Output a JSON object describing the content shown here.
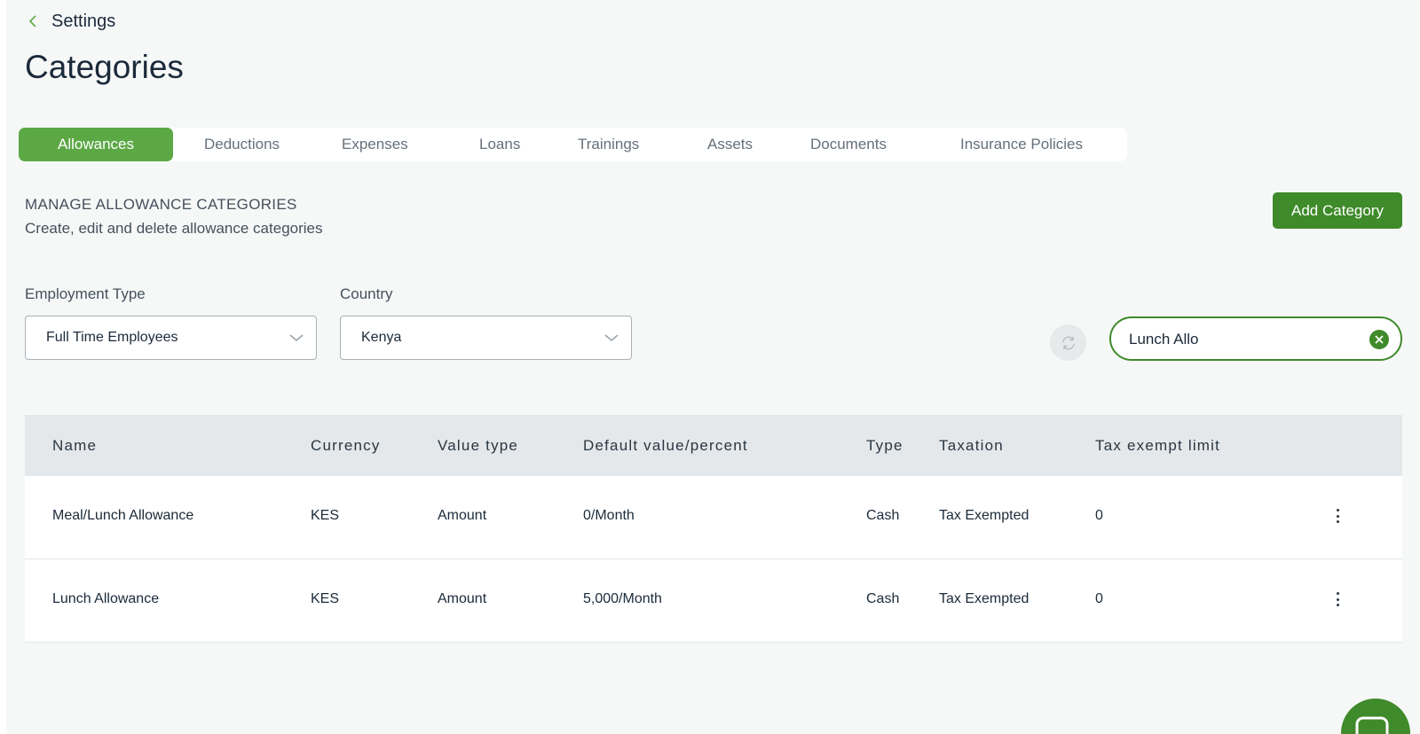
{
  "header": {
    "back_label": "Settings",
    "title": "Categories"
  },
  "tabs": [
    {
      "label": "Allowances",
      "active": true
    },
    {
      "label": "Deductions",
      "active": false
    },
    {
      "label": "Expenses",
      "active": false
    },
    {
      "label": "Loans",
      "active": false
    },
    {
      "label": "Trainings",
      "active": false
    },
    {
      "label": "Assets",
      "active": false
    },
    {
      "label": "Documents",
      "active": false
    },
    {
      "label": "Insurance Policies",
      "active": false
    }
  ],
  "section": {
    "title": "MANAGE ALLOWANCE CATEGORIES",
    "subtitle": "Create, edit and delete allowance categories",
    "add_button": "Add Category"
  },
  "filters": {
    "employment_type": {
      "label": "Employment Type",
      "value": "Full Time Employees"
    },
    "country": {
      "label": "Country",
      "value": "Kenya"
    },
    "search": {
      "value": "Lunch Allo"
    }
  },
  "table": {
    "columns": [
      "Name",
      "Currency",
      "Value type",
      "Default value/percent",
      "Type",
      "Taxation",
      "Tax exempt limit"
    ],
    "rows": [
      [
        "Meal/Lunch Allowance",
        "KES",
        "Amount",
        "0/Month",
        "Cash",
        "Tax Exempted",
        "0"
      ],
      [
        "Lunch Allowance",
        "KES",
        "Amount",
        "5,000/Month",
        "Cash",
        "Tax Exempted",
        "0"
      ]
    ]
  },
  "colors": {
    "accent": "#5ca845",
    "accent_dark": "#3f8a2a",
    "background": "#f6f8f8",
    "table_header": "#e4e8eb"
  },
  "icons": [
    "chevron-left-icon",
    "chevron-down-icon",
    "refresh-icon",
    "close-icon",
    "more-vertical-icon",
    "chat-icon"
  ]
}
